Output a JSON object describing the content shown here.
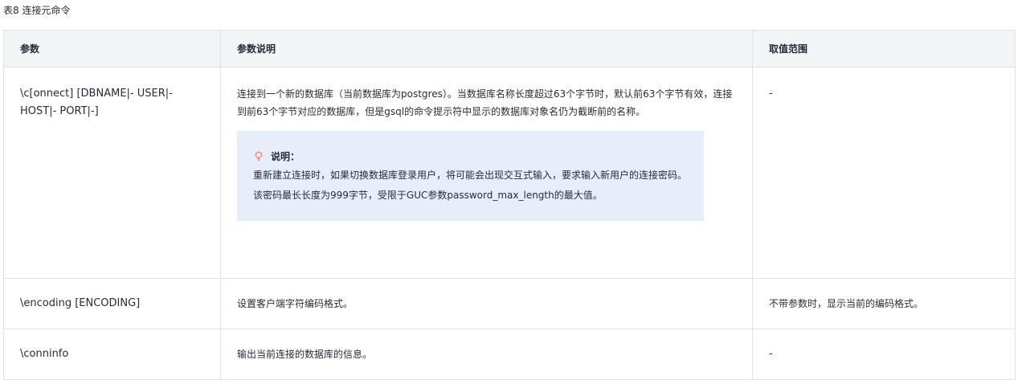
{
  "caption": "表8 连接元命令",
  "table": {
    "headers": [
      "参数",
      "参数说明",
      "取值范围"
    ],
    "rows": [
      {
        "param": "\\c[onnect]  [DBNAME|- USER|- HOST|- PORT|-]",
        "description": "连接到一个新的数据库（当前数据库为postgres）。当数据库名称长度超过63个字节时，默认前63个字节有效，连接到前63个字节对应的数据库，但是gsql的命令提示符中显示的数据库对象名仍为截断前的名称。",
        "note": {
          "title": "说明：",
          "body": "重新建立连接时，如果切换数据库登录用户，将可能会出现交互式输入，要求输入新用户的连接密码。该密码最长长度为999字节，受限于GUC参数password_max_length的最大值。"
        },
        "range": "-"
      },
      {
        "param": "\\encoding [ENCODING]",
        "description": "设置客户端字符编码格式。",
        "range": "不带参数时，显示当前的编码格式。"
      },
      {
        "param": "\\conninfo",
        "description": "输出当前连接的数据库的信息。",
        "range": "-"
      }
    ]
  },
  "colors": {
    "header_bg": "#f3f4f6",
    "border": "#dfe1e6",
    "note_bg": "#e8eef9",
    "note_icon": "#f0806b"
  },
  "icons": {
    "note": "lightbulb-icon"
  }
}
